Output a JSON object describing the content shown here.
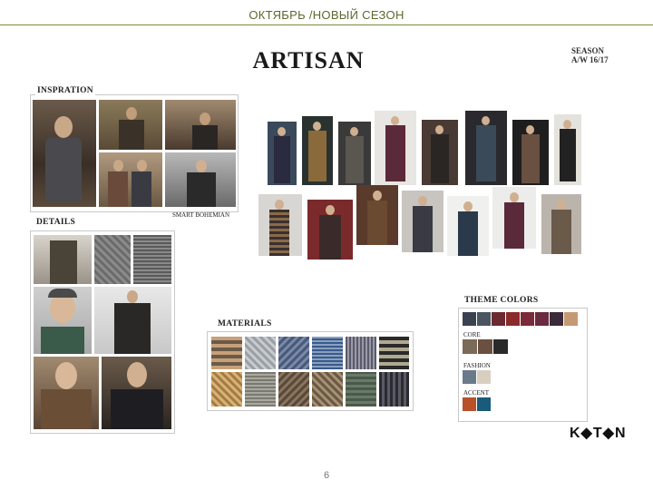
{
  "header": {
    "title": "ОКТЯБРЬ /НОВЫЙ СЕЗОН"
  },
  "board": {
    "title": "ARTISAN",
    "season_line1": "SEASON",
    "season_line2": "A/W 16/17"
  },
  "inspiration": {
    "label": "INSPRATION",
    "caption": "SMART BOHEMIAN"
  },
  "details": {
    "label": "DETAILS"
  },
  "materials": {
    "label": "MATERIALS"
  },
  "theme_colors": {
    "label": "THEME COLORS",
    "core_label": "CORE",
    "fashion_label": "FASHION",
    "accent_label": "ACCENT",
    "main_row": [
      "#3a4250",
      "#4a5560",
      "#6a2a30",
      "#8a2a2a",
      "#7a2a38",
      "#6a2a40",
      "#3a2a3a",
      "#c49a72"
    ],
    "core": [
      "#7a6a58",
      "#6a5040",
      "#2a2a2a"
    ],
    "fashion": [
      "#6a7a8a",
      "#d8cfc0"
    ],
    "accent": [
      "#b8502a",
      "#1a5a7a"
    ]
  },
  "brand": {
    "logo_text": "K◆T◆N"
  },
  "footer": {
    "page_number": "6"
  }
}
